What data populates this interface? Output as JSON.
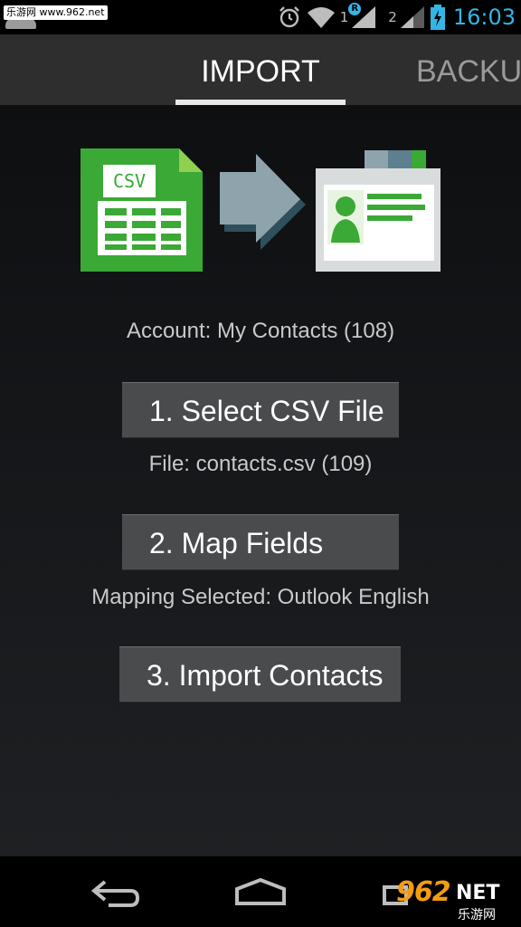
{
  "status_bar": {
    "watermark": "乐游网 www.962.net",
    "sim1_label": "1",
    "sim2_label": "2",
    "roaming_badge": "R",
    "time": "16:03",
    "icons": [
      "alarm-icon",
      "wifi-icon",
      "signal-icon",
      "battery-charging-icon"
    ],
    "accent_color": "#33b5e5"
  },
  "tabs": [
    {
      "label": "IMPORT",
      "selected": true
    },
    {
      "label": "BACKU",
      "selected": false
    }
  ],
  "hero": {
    "csv_label": "CSV",
    "icons": [
      "csv-file-icon",
      "arrow-right-icon",
      "contact-card-icon"
    ],
    "accent_color": "#3aa935"
  },
  "main": {
    "account_text": "Account: My Contacts (108)",
    "select_button": "1. Select CSV File",
    "file_text": "File: contacts.csv (109)",
    "map_button": "2. Map Fields",
    "mapping_text": "Mapping Selected: Outlook English",
    "import_button": "3. Import Contacts"
  },
  "nav_bar": {
    "icons": [
      "back-icon",
      "home-icon",
      "recent-apps-icon"
    ],
    "watermark_number": "962",
    "watermark_net": "NET",
    "watermark_cn": "乐游网"
  }
}
